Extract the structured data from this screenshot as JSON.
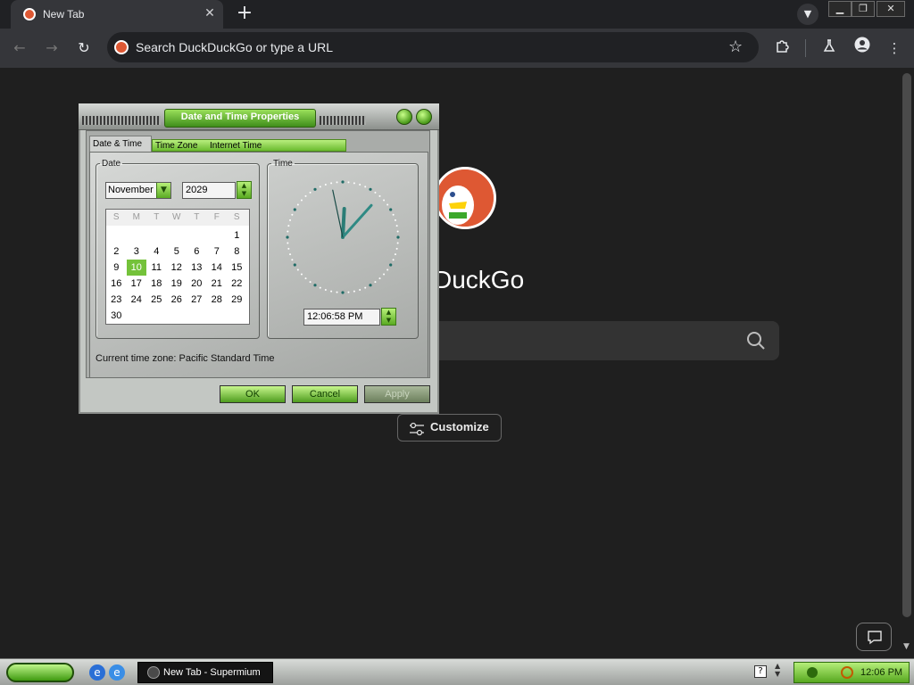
{
  "browser": {
    "tab_title": "New Tab",
    "tab_close": "✕",
    "new_tab": "+",
    "omnibox_placeholder": "Search DuckDuckGo or type a URL"
  },
  "page": {
    "wordmark": "DuckGo",
    "customize_label": "Customize"
  },
  "dialog": {
    "title": "Date and Time Properties",
    "tabs": [
      "Date & Time",
      "Time Zone",
      "Internet Time"
    ],
    "date_group_label": "Date",
    "time_group_label": "Time",
    "month": "November",
    "year": "2029",
    "weekday_headers": [
      "S",
      "M",
      "T",
      "W",
      "T",
      "F",
      "S"
    ],
    "calendar_weeks": [
      [
        "",
        "",
        "",
        "",
        "",
        "",
        "1"
      ],
      [
        "2",
        "3",
        "4",
        "5",
        "6",
        "7",
        "8"
      ],
      [
        "9",
        "10",
        "11",
        "12",
        "13",
        "14",
        "15"
      ],
      [
        "16",
        "17",
        "18",
        "19",
        "20",
        "21",
        "22"
      ],
      [
        "23",
        "24",
        "25",
        "26",
        "27",
        "28",
        "29"
      ],
      [
        "30",
        "",
        "",
        "",
        "",
        "",
        ""
      ]
    ],
    "selected_day": "10",
    "time_value": "12:06:58 PM",
    "timezone_text": "Current time zone:  Pacific Standard Time",
    "buttons": {
      "ok": "OK",
      "cancel": "Cancel",
      "apply": "Apply"
    }
  },
  "taskbar": {
    "task_label": "New Tab - Supermium",
    "tray_time": "12:06 PM",
    "help_glyph": "?"
  },
  "colors": {
    "accent_green": "#5aab22",
    "ddg_orange": "#de5833"
  }
}
